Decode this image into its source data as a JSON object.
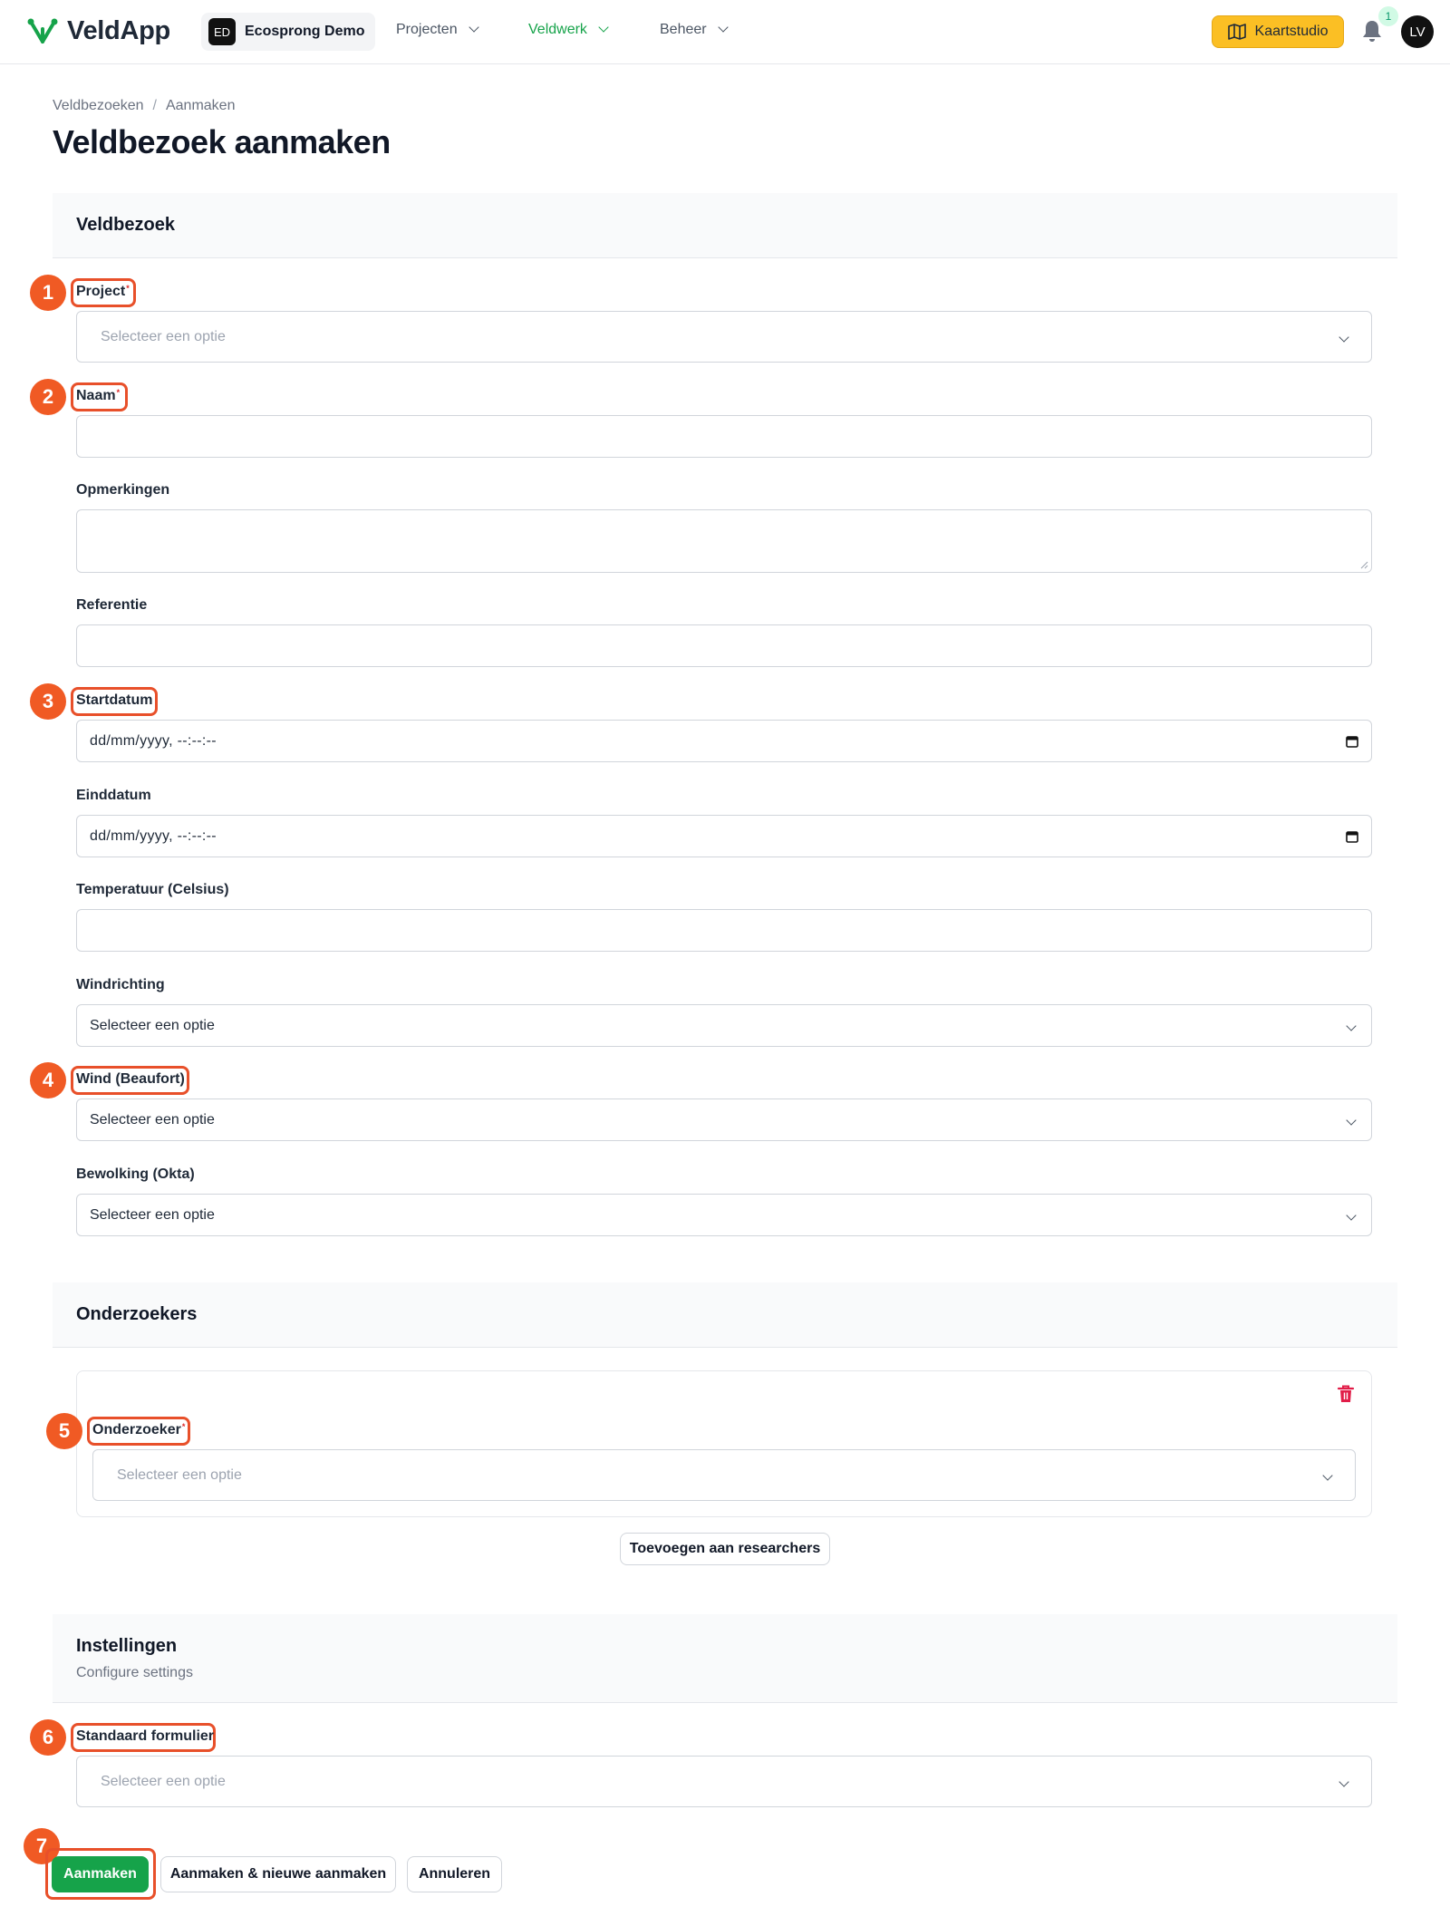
{
  "app": {
    "name": "VeldApp"
  },
  "tenant": {
    "initials": "ED",
    "name": "Ecosprong Demo"
  },
  "nav": {
    "items": [
      {
        "label": "Projecten"
      },
      {
        "label": "Veldwerk"
      },
      {
        "label": "Beheer"
      }
    ]
  },
  "header": {
    "kaartstudio_label": "Kaartstudio",
    "notification_count": "1",
    "user_initials": "LV"
  },
  "breadcrumb": {
    "items": [
      "Veldbezoeken",
      "Aanmaken"
    ],
    "separator": "/"
  },
  "page": {
    "title": "Veldbezoek aanmaken"
  },
  "sections": {
    "veldbezoek": {
      "title": "Veldbezoek"
    },
    "onderzoekers": {
      "title": "Onderzoekers"
    },
    "instellingen": {
      "title": "Instellingen",
      "subtitle": "Configure settings"
    }
  },
  "fields": {
    "project": {
      "label": "Project",
      "placeholder": "Selecteer een optie"
    },
    "naam": {
      "label": "Naam",
      "value": ""
    },
    "opmerkingen": {
      "label": "Opmerkingen",
      "value": ""
    },
    "referentie": {
      "label": "Referentie",
      "value": ""
    },
    "startdatum": {
      "label": "Startdatum",
      "value": "dd/mm/yyyy, --:--:--"
    },
    "einddatum": {
      "label": "Einddatum",
      "value": "dd/mm/yyyy, --:--:--"
    },
    "temperatuur": {
      "label": "Temperatuur (Celsius)",
      "value": ""
    },
    "windrichting": {
      "label": "Windrichting",
      "value": "Selecteer een optie"
    },
    "wind": {
      "label": "Wind (Beaufort)",
      "value": "Selecteer een optie"
    },
    "bewolking": {
      "label": "Bewolking (Okta)",
      "value": "Selecteer een optie"
    },
    "onderzoeker": {
      "label": "Onderzoeker",
      "placeholder": "Selecteer een optie"
    },
    "standaard_formulier": {
      "label": "Standaard formulier",
      "placeholder": "Selecteer een optie"
    }
  },
  "required_marker": "*",
  "buttons": {
    "add_researcher": "Toevoegen aan researchers",
    "create": "Aanmaken",
    "create_and_new": "Aanmaken & nieuwe aanmaken",
    "cancel": "Annuleren"
  },
  "annotations": [
    "1",
    "2",
    "3",
    "4",
    "5",
    "6",
    "7"
  ],
  "colors": {
    "accent": "#16a34a",
    "kaartstudio": "#fbbf24",
    "annotation": "#f05a24",
    "required": "#dc2626",
    "trash": "#e11d48"
  }
}
